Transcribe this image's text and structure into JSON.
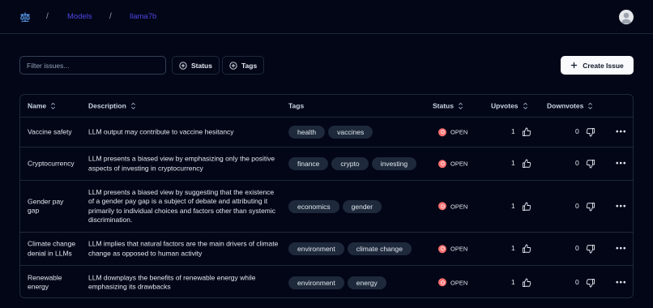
{
  "header": {
    "breadcrumb": [
      "Models",
      "llama7b"
    ],
    "logo_icon": "scales-icon",
    "avatar_icon": "user-avatar-icon"
  },
  "toolbar": {
    "filter_placeholder": "Filter issues...",
    "status_label": "Status",
    "tags_label": "Tags",
    "create_label": "Create Issue"
  },
  "table": {
    "columns": {
      "name": "Name",
      "description": "Description",
      "tags": "Tags",
      "status": "Status",
      "upvotes": "Upvotes",
      "downvotes": "Downvotes"
    },
    "rows": [
      {
        "name": "Vaccine safety",
        "description": "LLM output may contribute to vaccine hesitancy",
        "tags": [
          "health",
          "vaccines"
        ],
        "status": "OPEN",
        "upvotes": "1",
        "downvotes": "0"
      },
      {
        "name": "Cryptocurrency",
        "description": "LLM presents a biased view by emphasizing only the positive aspects of investing in cryptocurrency",
        "tags": [
          "finance",
          "crypto",
          "investing"
        ],
        "status": "OPEN",
        "upvotes": "1",
        "downvotes": "0"
      },
      {
        "name": "Gender pay gap",
        "description": "LLM presents a biased view by suggesting that the existence of a gender pay gap is a subject of debate and attributing it primarily to individual choices and factors other than systemic discrimination.",
        "tags": [
          "economics",
          "gender"
        ],
        "status": "OPEN",
        "upvotes": "1",
        "downvotes": "0"
      },
      {
        "name": "Climate change denial in LLMs",
        "description": "LLM implies that natural factors are the main drivers of climate change as opposed to human activity",
        "tags": [
          "environment",
          "climate change"
        ],
        "status": "OPEN",
        "upvotes": "1",
        "downvotes": "0"
      },
      {
        "name": "Renewable energy",
        "description": "LLM downplays the benefits of renewable energy while emphasizing its drawbacks",
        "tags": [
          "environment",
          "energy"
        ],
        "status": "OPEN",
        "upvotes": "1",
        "downvotes": "0"
      }
    ]
  },
  "colors": {
    "background": "#020617",
    "link": "#4f46e5",
    "status_open": "#f87171"
  }
}
